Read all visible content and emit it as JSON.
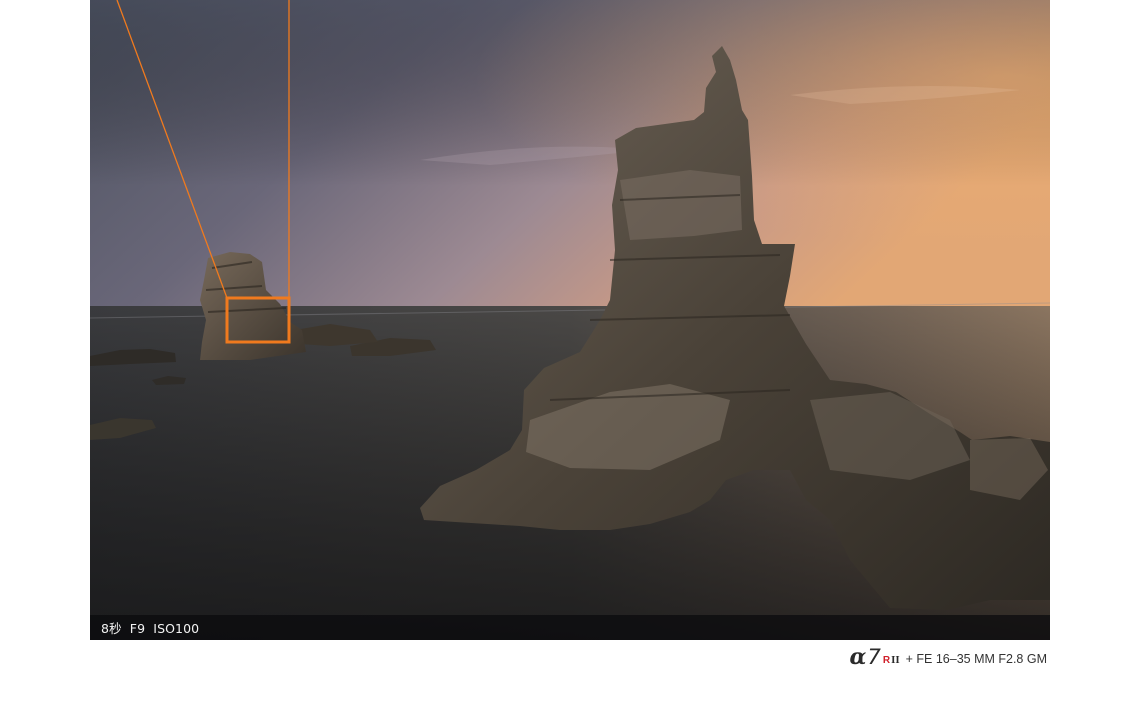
{
  "photo": {
    "description_icon": "seascape-photo",
    "exif": "8秒  F9  ISO100",
    "highlight_color": "#f07a1e"
  },
  "caption": {
    "alpha": "α",
    "model_number": "7",
    "model_suffix": "R",
    "model_roman": "II",
    "lens": "+ FE 16–35 MM F2.8 GM",
    "suffix_color": "#d01f2a"
  }
}
